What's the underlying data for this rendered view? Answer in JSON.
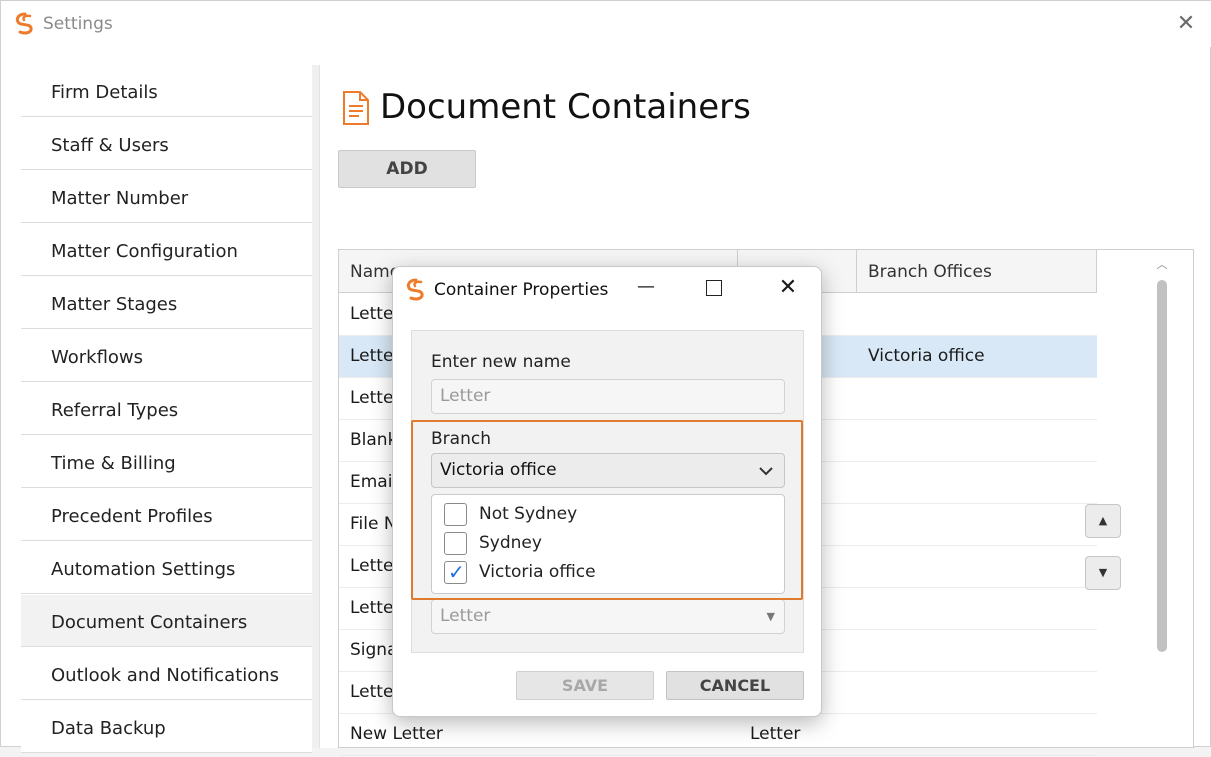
{
  "window": {
    "title": "Settings",
    "close_glyph": "✕"
  },
  "sidebar": {
    "items": [
      {
        "label": "Firm Details",
        "active": false
      },
      {
        "label": "Staff & Users",
        "active": false
      },
      {
        "label": "Matter Number",
        "active": false
      },
      {
        "label": "Matter Configuration",
        "active": false
      },
      {
        "label": "Matter Stages",
        "active": false
      },
      {
        "label": "Workflows",
        "active": false
      },
      {
        "label": "Referral Types",
        "active": false
      },
      {
        "label": "Time & Billing",
        "active": false
      },
      {
        "label": "Precedent Profiles",
        "active": false
      },
      {
        "label": "Automation Settings",
        "active": false
      },
      {
        "label": "Document Containers",
        "active": true
      },
      {
        "label": "Outlook and Notifications",
        "active": false
      },
      {
        "label": "Data Backup",
        "active": false
      }
    ]
  },
  "main": {
    "title": "Document Containers",
    "add_label": "ADD",
    "columns": [
      "Name",
      "Branch Offices"
    ],
    "rows": [
      {
        "name": "Lette",
        "type": "",
        "branch": ""
      },
      {
        "name": "Lette",
        "type": "",
        "branch": "Victoria office",
        "selected": true
      },
      {
        "name": "Letter",
        "type": "",
        "branch": ""
      },
      {
        "name": "Blank",
        "type": "",
        "branch": ""
      },
      {
        "name": "Email",
        "type": "",
        "branch": ""
      },
      {
        "name": "File N",
        "type": "",
        "branch": ""
      },
      {
        "name": "Lette",
        "type": "",
        "branch": ""
      },
      {
        "name": "Lette",
        "type": "",
        "branch": ""
      },
      {
        "name": "Signa",
        "type": "",
        "branch": ""
      },
      {
        "name": "Lette",
        "type": "",
        "branch": ""
      },
      {
        "name": "New Letter",
        "type": "Letter",
        "branch": ""
      }
    ],
    "move_up_glyph": "▲",
    "move_down_glyph": "▼"
  },
  "dialog": {
    "title": "Container Properties",
    "name_label": "Enter new name",
    "name_placeholder": "Letter",
    "branch_label": "Branch",
    "branch_selected": "Victoria office",
    "branch_options": [
      {
        "label": "Not Sydney",
        "checked": false
      },
      {
        "label": "Sydney",
        "checked": false
      },
      {
        "label": "Victoria office",
        "checked": true
      }
    ],
    "type_value": "Letter",
    "save_label": "SAVE",
    "cancel_label": "CANCEL"
  },
  "colors": {
    "accent": "#e07a2e",
    "selection": "#d8e8f6",
    "check": "#1e6fd9"
  }
}
